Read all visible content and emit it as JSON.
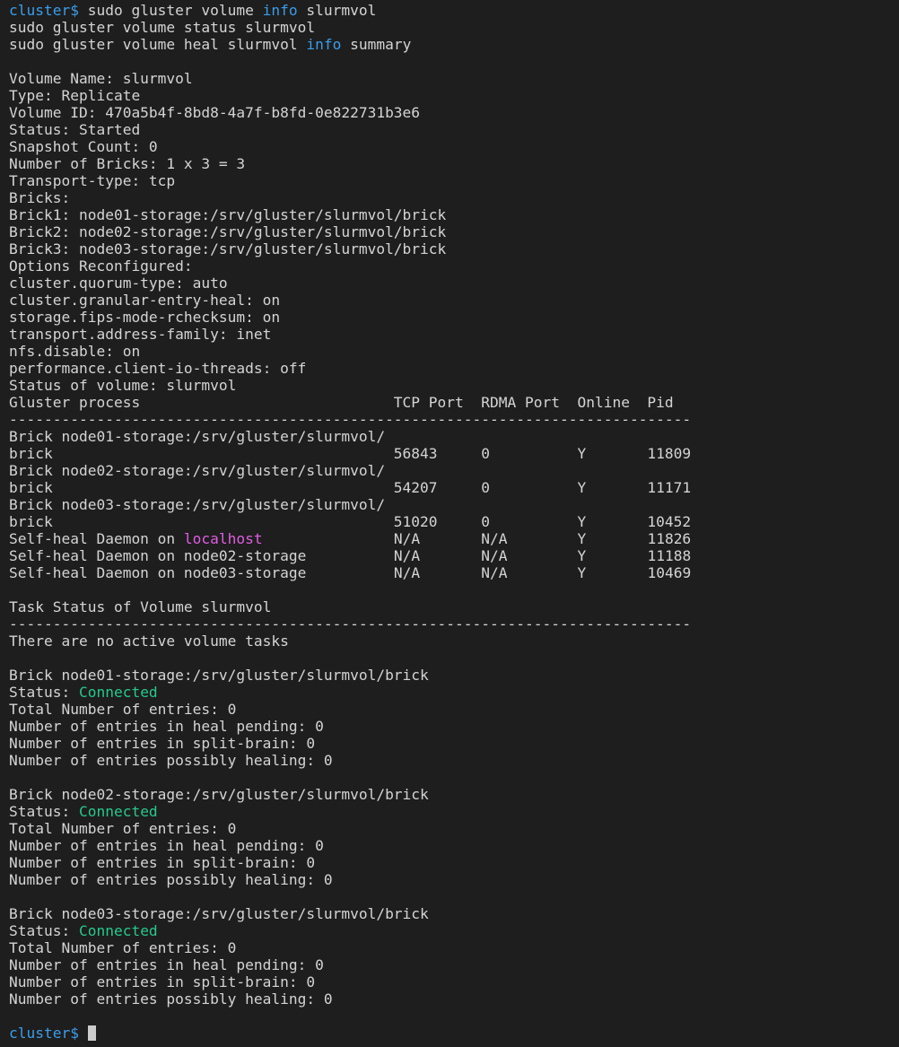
{
  "terminal": {
    "prompt": "cluster$",
    "commands": [
      {
        "pre": "sudo gluster volume ",
        "kw": "info",
        "post": " slurmvol"
      },
      {
        "text": "sudo gluster volume status slurmvol"
      },
      {
        "pre": "sudo gluster volume heal slurmvol ",
        "kw": "info",
        "post": " summary"
      }
    ],
    "volume_info": [
      "Volume Name: slurmvol",
      "Type: Replicate",
      "Volume ID: 470a5b4f-8bd8-4a7f-b8fd-0e822731b3e6",
      "Status: Started",
      "Snapshot Count: 0",
      "Number of Bricks: 1 x 3 = 3",
      "Transport-type: tcp",
      "Bricks:",
      "Brick1: node01-storage:/srv/gluster/slurmvol/brick",
      "Brick2: node02-storage:/srv/gluster/slurmvol/brick",
      "Brick3: node03-storage:/srv/gluster/slurmvol/brick",
      "Options Reconfigured:",
      "cluster.quorum-type: auto",
      "cluster.granular-entry-heal: on",
      "storage.fips-mode-rchecksum: on",
      "transport.address-family: inet",
      "nfs.disable: on",
      "performance.client-io-threads: off",
      "Status of volume: slurmvol"
    ],
    "status_table": {
      "headers": [
        "Gluster process",
        "TCP Port",
        "RDMA Port",
        "Online",
        "Pid"
      ],
      "separator": "------------------------------------------------------------------------------",
      "bricks": [
        {
          "name": "Brick node01-storage:/srv/gluster/slurmvol/",
          "name2": "brick",
          "tcp": "56843",
          "rdma": "0",
          "online": "Y",
          "pid": "11809"
        },
        {
          "name": "Brick node02-storage:/srv/gluster/slurmvol/",
          "name2": "brick",
          "tcp": "54207",
          "rdma": "0",
          "online": "Y",
          "pid": "11171"
        },
        {
          "name": "Brick node03-storage:/srv/gluster/slurmvol/",
          "name2": "brick",
          "tcp": "51020",
          "rdma": "0",
          "online": "Y",
          "pid": "10452"
        }
      ],
      "daemons": [
        {
          "pre": "Self-heal Daemon on ",
          "host": "localhost",
          "host_colored": true,
          "tcp": "N/A",
          "rdma": "N/A",
          "online": "Y",
          "pid": "11826"
        },
        {
          "pre": "Self-heal Daemon on ",
          "host": "node02-storage",
          "host_colored": false,
          "tcp": "N/A",
          "rdma": "N/A",
          "online": "Y",
          "pid": "11188"
        },
        {
          "pre": "Self-heal Daemon on ",
          "host": "node03-storage",
          "host_colored": false,
          "tcp": "N/A",
          "rdma": "N/A",
          "online": "Y",
          "pid": "10469"
        }
      ]
    },
    "task_status": {
      "title": "Task Status of Volume slurmvol",
      "separator": "------------------------------------------------------------------------------",
      "message": "There are no active volume tasks"
    },
    "heal_summary": [
      {
        "brick": "Brick node01-storage:/srv/gluster/slurmvol/brick",
        "status_label": "Status: ",
        "status": "Connected",
        "lines": [
          "Total Number of entries: 0",
          "Number of entries in heal pending: 0",
          "Number of entries in split-brain: 0",
          "Number of entries possibly healing: 0"
        ]
      },
      {
        "brick": "Brick node02-storage:/srv/gluster/slurmvol/brick",
        "status_label": "Status: ",
        "status": "Connected",
        "lines": [
          "Total Number of entries: 0",
          "Number of entries in heal pending: 0",
          "Number of entries in split-brain: 0",
          "Number of entries possibly healing: 0"
        ]
      },
      {
        "brick": "Brick node03-storage:/srv/gluster/slurmvol/brick",
        "status_label": "Status: ",
        "status": "Connected",
        "lines": [
          "Total Number of entries: 0",
          "Number of entries in heal pending: 0",
          "Number of entries in split-brain: 0",
          "Number of entries possibly healing: 0"
        ]
      }
    ],
    "colors": {
      "background": "#1e1e1e",
      "foreground": "#d4d4d4",
      "keyword": "#3b9dea",
      "host": "#e05ce0",
      "connected": "#27c98a"
    }
  }
}
